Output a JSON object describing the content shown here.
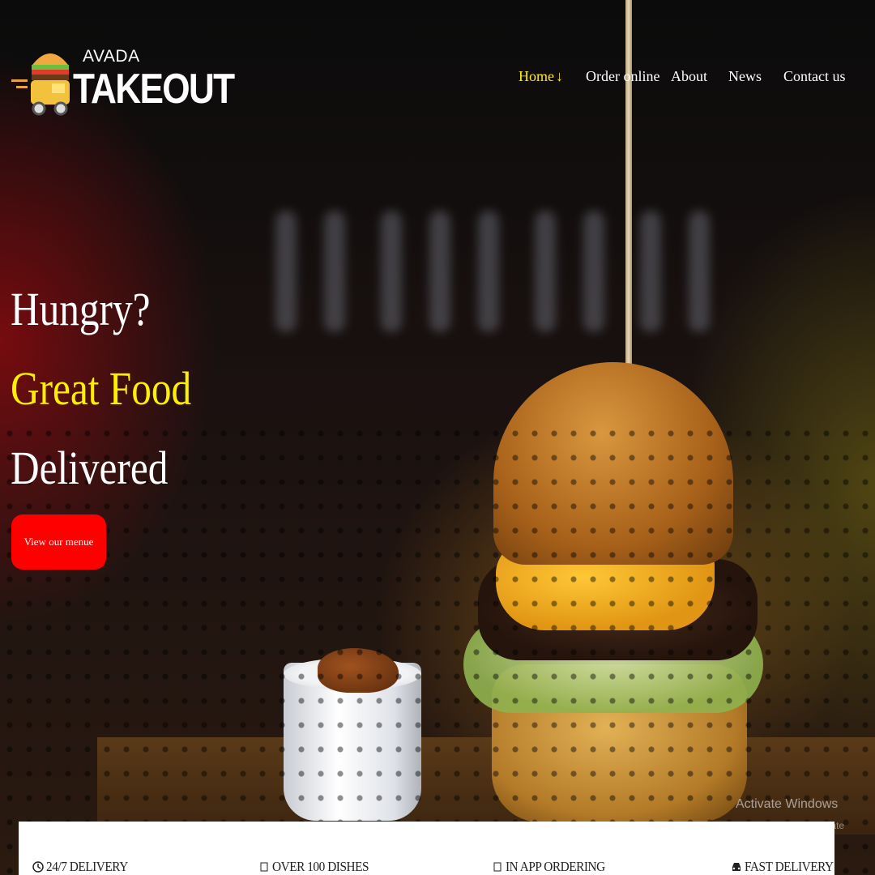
{
  "logo": {
    "small_text": "AVADA",
    "big_text": "TAKEOUT"
  },
  "nav": {
    "items": [
      {
        "label": "Home",
        "active": true
      },
      {
        "label": "Order online"
      },
      {
        "label": "About"
      },
      {
        "label": "News"
      },
      {
        "label": "Contact us"
      }
    ],
    "active_icon": "arrow-down-icon"
  },
  "hero": {
    "line1": "Hungry?",
    "line2": "Great Food",
    "line3": "Delivered",
    "cta_label": "View our menue"
  },
  "features": [
    {
      "icon": "clock-icon",
      "label": "24/7 DELIVERY"
    },
    {
      "icon": "dish-icon",
      "label": "OVER 100 DISHES"
    },
    {
      "icon": "phone-icon",
      "label": "IN APP ORDERING"
    },
    {
      "icon": "car-icon",
      "label": "FAST DELIVERY"
    }
  ],
  "watermark": {
    "title": "Activate Windows",
    "subtitle": "Go to Settings to activate Windows."
  },
  "colors": {
    "accent_yellow": "#ffef00",
    "cta_red": "#ff0000"
  }
}
